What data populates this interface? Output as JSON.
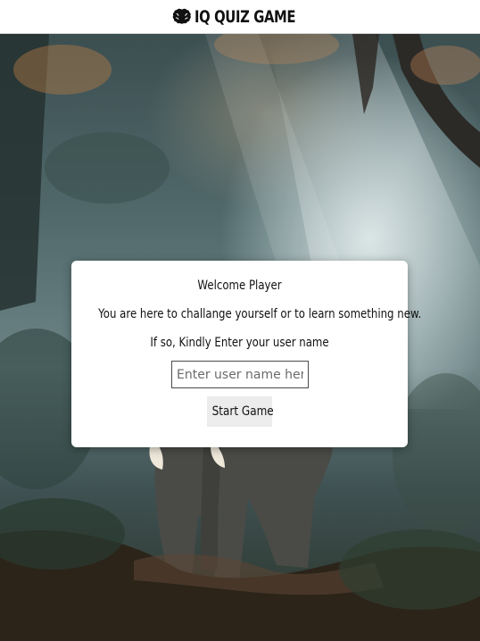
{
  "header": {
    "logo_icon": "brain-icon",
    "title": "IQ QUIZ GAME"
  },
  "welcome": {
    "greeting": "Welcome Player",
    "subtitle": "You are here to challange yourself or to learn something new.",
    "prompt": "If so, Kindly Enter your user name",
    "username_input": {
      "value": "",
      "placeholder": "Enter user name here"
    },
    "start_label": "Start Game"
  },
  "colors": {
    "header_bg": "#ffffff",
    "card_bg": "#ffffff",
    "button_bg": "#ececec"
  }
}
